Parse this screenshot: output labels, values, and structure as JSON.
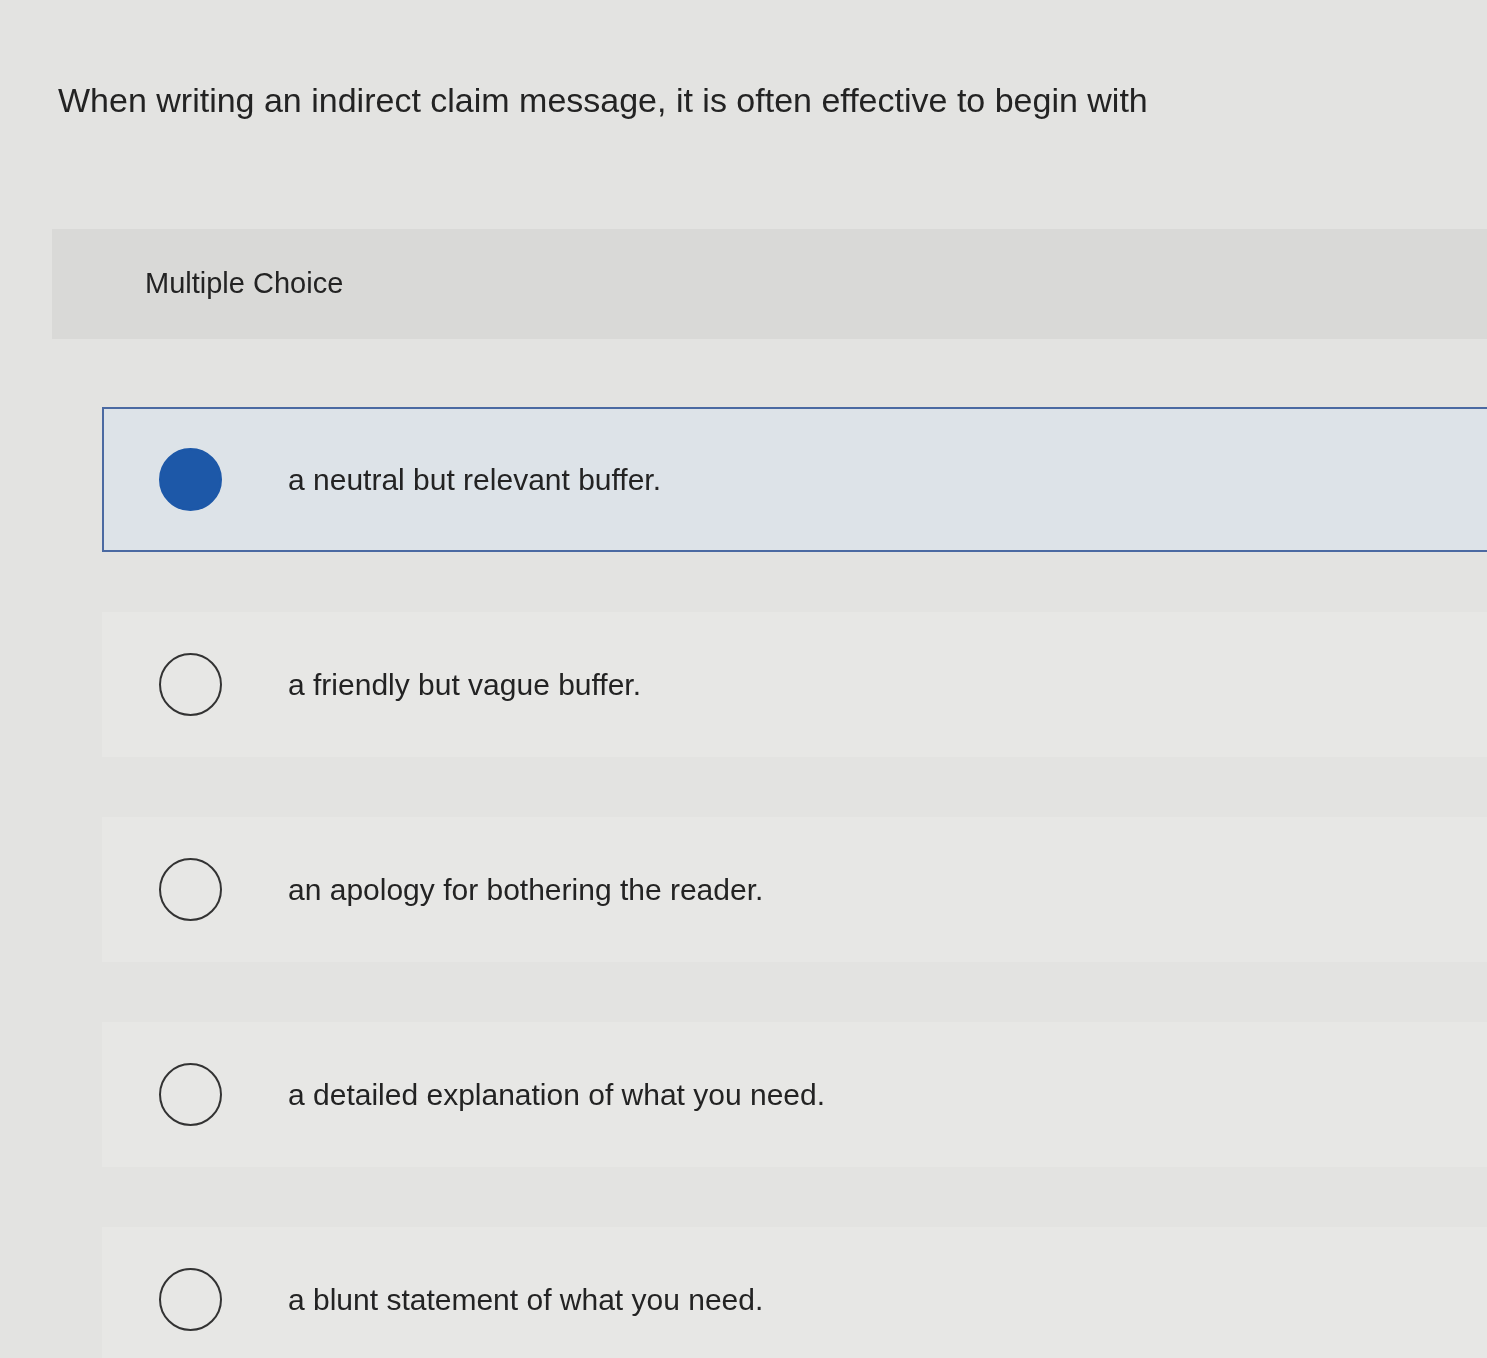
{
  "question": "When writing an indirect claim message, it is often effective to begin with",
  "panel": {
    "label": "Multiple Choice"
  },
  "options": [
    {
      "text": "a neutral but relevant buffer.",
      "selected": true
    },
    {
      "text": "a friendly but vague buffer.",
      "selected": false
    },
    {
      "text": "an apology for bothering the reader.",
      "selected": false
    },
    {
      "text": "a detailed explanation of what you need.",
      "selected": false
    },
    {
      "text": "a blunt statement of what you need.",
      "selected": false
    }
  ]
}
